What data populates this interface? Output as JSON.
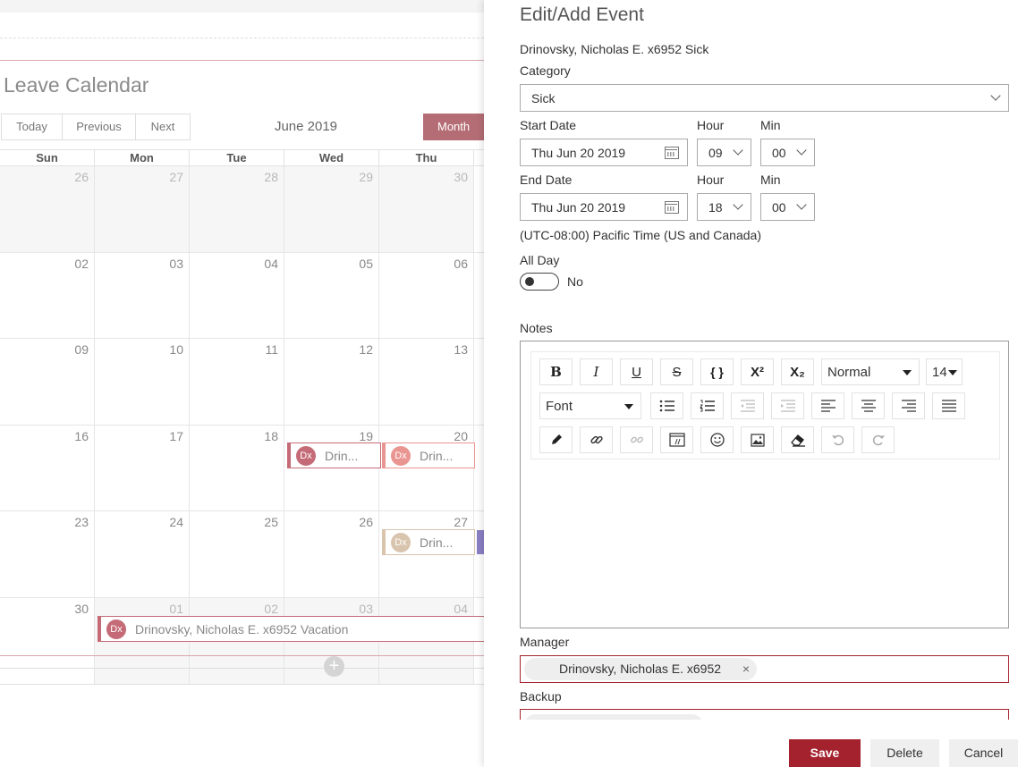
{
  "calendar": {
    "title": "Leave Calendar",
    "nav": {
      "today": "Today",
      "previous": "Previous",
      "next": "Next",
      "month": "Month"
    },
    "month_label": "June 2019",
    "weekdays": [
      "Sun",
      "Mon",
      "Tue",
      "Wed",
      "Thu"
    ],
    "weeks": [
      [
        "26",
        "27",
        "28",
        "29",
        "30"
      ],
      [
        "02",
        "03",
        "04",
        "05",
        "06"
      ],
      [
        "09",
        "10",
        "11",
        "12",
        "13"
      ],
      [
        "16",
        "17",
        "18",
        "19",
        "20"
      ],
      [
        "23",
        "24",
        "25",
        "26",
        "27"
      ],
      [
        "30",
        "01",
        "02",
        "03",
        "04"
      ]
    ],
    "events": [
      {
        "initials": "Dx",
        "label": "Drin...",
        "color": "#c46b77"
      },
      {
        "initials": "Dx",
        "label": "Drin...",
        "color": "#e99591"
      },
      {
        "initials": "Dx",
        "label": "Drin...",
        "color": "#d9c4ad"
      },
      {
        "initials": "Dx",
        "label": "Drinovsky, Nicholas E. x6952 Vacation",
        "color": "#c46b77"
      }
    ],
    "add_symbol": "+"
  },
  "panel": {
    "title": "Edit/Add Event",
    "subtitle": "Drinovsky, Nicholas E. x6952 Sick",
    "category": {
      "label": "Category",
      "value": "Sick"
    },
    "start": {
      "label": "Start Date",
      "date": "Thu Jun 20 2019",
      "hour_label": "Hour",
      "hour": "09",
      "min_label": "Min",
      "min": "00"
    },
    "end": {
      "label": "End Date",
      "date": "Thu Jun 20 2019",
      "hour_label": "Hour",
      "hour": "18",
      "min_label": "Min",
      "min": "00"
    },
    "timezone": "(UTC-08:00) Pacific Time (US and Canada)",
    "all_day": {
      "label": "All Day",
      "value": "No"
    },
    "notes": {
      "label": "Notes",
      "format": "Normal",
      "size": "14",
      "font": "Font",
      "bold": "B",
      "italic": "I",
      "underline": "U",
      "strike": "S",
      "code": "{ }",
      "superscript": "X²",
      "subscript": "X₂"
    },
    "manager": {
      "label": "Manager",
      "value": "Drinovsky, Nicholas E. x6952"
    },
    "backup": {
      "label": "Backup"
    },
    "buttons": {
      "save": "Save",
      "delete": "Delete",
      "cancel": "Cancel"
    },
    "remove_symbol": "×"
  }
}
